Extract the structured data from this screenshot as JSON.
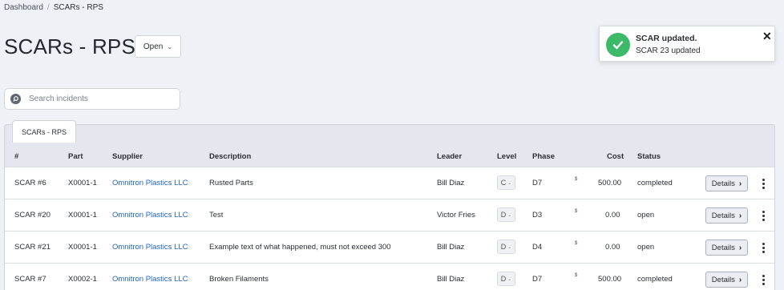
{
  "breadcrumb": {
    "home": "Dashboard",
    "separator": "/",
    "current": "SCARs - RPS"
  },
  "page_title": "SCARs - RPS",
  "status_filter": {
    "value": "Open",
    "chevron": "⌄"
  },
  "search": {
    "placeholder": "Search incidents",
    "value": ""
  },
  "tabs": [
    {
      "label": "SCARs - RPS"
    }
  ],
  "table": {
    "columns": {
      "num": "#",
      "part": "Part",
      "supplier": "Supplier",
      "description": "Description",
      "leader": "Leader",
      "level": "Level",
      "phase": "Phase",
      "cost": "Cost",
      "status": "Status"
    },
    "rows": [
      {
        "num": "SCAR #6",
        "part": "X0001-1",
        "supplier": "Omnitron Plastics LLC",
        "description": "Rusted Parts",
        "leader": "Bill Diaz",
        "level": "C",
        "phase": "D7",
        "currency": "$",
        "cost": "500.00",
        "status": "completed",
        "details": "Details",
        "details_chevron": "›"
      },
      {
        "num": "SCAR #20",
        "part": "X0001-1",
        "supplier": "Omnitron Plastics LLC",
        "description": "Test",
        "leader": "Victor Fries",
        "level": "D",
        "phase": "D3",
        "currency": "$",
        "cost": "0.00",
        "status": "open",
        "details": "Details",
        "details_chevron": "›"
      },
      {
        "num": "SCAR #21",
        "part": "X0001-1",
        "supplier": "Omnitron Plastics LLC",
        "description": "Example text of what happened, must not exceed 300",
        "leader": "Bill Diaz",
        "level": "D",
        "phase": "D4",
        "currency": "$",
        "cost": "0.00",
        "status": "open",
        "details": "Details",
        "details_chevron": "›"
      },
      {
        "num": "SCAR #7",
        "part": "X0002-1",
        "supplier": "Omnitron Plastics LLC",
        "description": "Broken Filaments",
        "leader": "Bill Diaz",
        "level": "D",
        "phase": "D7",
        "currency": "$",
        "cost": "500.00",
        "status": "completed",
        "details": "Details",
        "details_chevron": "›"
      }
    ]
  },
  "toast": {
    "title": "SCAR updated.",
    "message": "SCAR 23 updated",
    "close": "✕",
    "icon": "check-circle-icon",
    "color": "#3cba6a"
  },
  "colors": {
    "link": "#2563c9",
    "background": "#eef1f5",
    "success": "#3cba6a"
  }
}
